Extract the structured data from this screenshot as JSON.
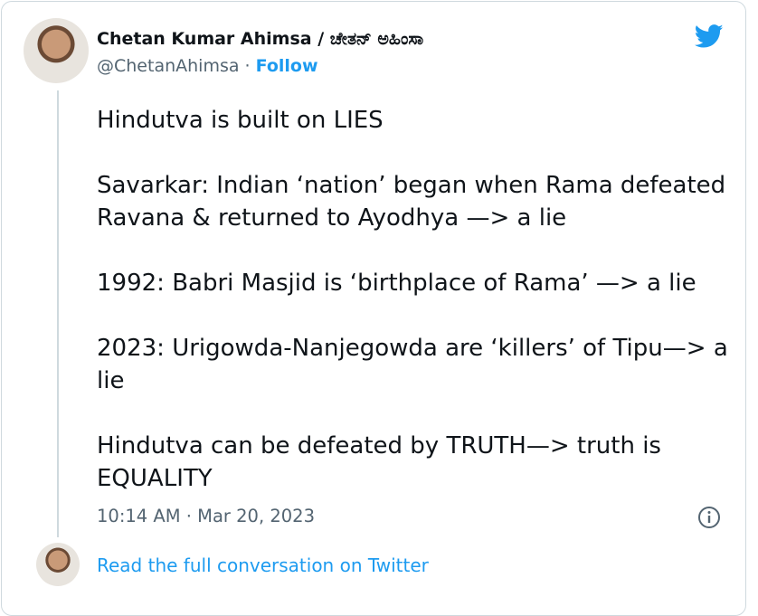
{
  "author": {
    "display_name": "Chetan Kumar Ahimsa / ಚೇತನ್ ಅಹಿಂಸಾ",
    "handle": "@ChetanAhimsa",
    "separator": " · ",
    "follow_label": "Follow",
    "avatar_icon": "profile-photo"
  },
  "tweet": {
    "text": "Hindutva is built on LIES\n\nSavarkar: Indian ‘nation’ began when Rama defeated Ravana & returned to Ayodhya —> a lie\n\n1992: Babri Masjid is ‘birthplace of Rama’ —> a lie\n\n2023: Urigowda-Nanjegowda are ‘killers’ of Tipu—> a lie\n\nHindutva can be defeated by TRUTH—> truth is EQUALITY",
    "timestamp": "10:14 AM · Mar 20, 2023"
  },
  "footer": {
    "conversation_link": "Read the full conversation on Twitter"
  },
  "icons": {
    "brand": "twitter-bird-icon",
    "info": "info-icon"
  },
  "colors": {
    "accent": "#1d9bf0",
    "text": "#0f1419",
    "muted": "#536471",
    "border": "#cfd9de"
  }
}
